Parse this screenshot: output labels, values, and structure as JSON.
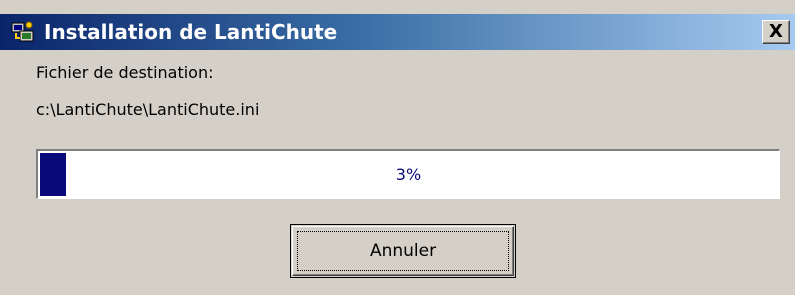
{
  "window": {
    "title": "Installation de LantiChute",
    "title_icon": "installer-icon",
    "close_label": "X",
    "titlebar_colors": [
      "#0a246a",
      "#a6caf0"
    ]
  },
  "content": {
    "destination_label": "Fichier de destination:",
    "destination_path": "c:\\LantiChute\\LantiChute.ini"
  },
  "progress": {
    "value_percent": 3,
    "text": "3%",
    "fill_color": "#0a0a7a"
  },
  "buttons": {
    "cancel_label": "Annuler"
  }
}
